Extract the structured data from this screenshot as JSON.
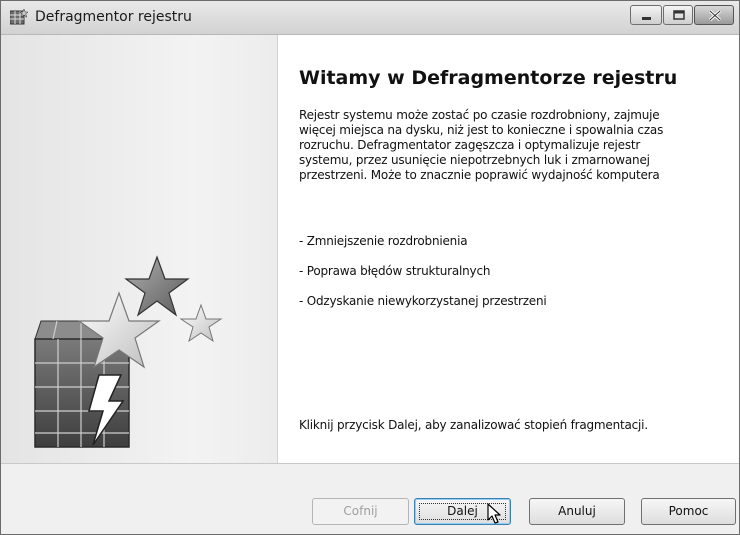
{
  "window": {
    "title": "Defragmentor rejestru"
  },
  "content": {
    "heading": "Witamy w Defragmentorze rejestru",
    "description": "Rejestr systemu może zostać po czasie rozdrobniony, zajmuje\nwięcej miejsca na dysku, niż jest to konieczne i spowalnia czas\nrozruchu. Defragmentator zagęszcza i optymalizuje rejestr\nsystemu, przez usunięcie niepotrzebnych luk i zmarnowanej\nprzestrzeni. Może to znacznie poprawić wydajność komputera",
    "bullets": [
      "- Zmniejszenie rozdrobnienia",
      "- Poprawa błędów strukturalnych",
      "- Odzyskanie niewykorzystanej przestrzeni"
    ],
    "hint": "Kliknij przycisk Dalej, aby zanalizować stopień fragmentacji."
  },
  "buttons": {
    "back": "Cofnij",
    "next": "Dalej",
    "cancel": "Anuluj",
    "help": "Pomoc"
  },
  "icons": {
    "app": "registry-defrag-icon",
    "illustration": "registry-stars-illustration",
    "minimize": "minimize-icon",
    "maximize": "maximize-icon",
    "close": "close-icon",
    "cursor": "mouse-pointer-icon"
  }
}
